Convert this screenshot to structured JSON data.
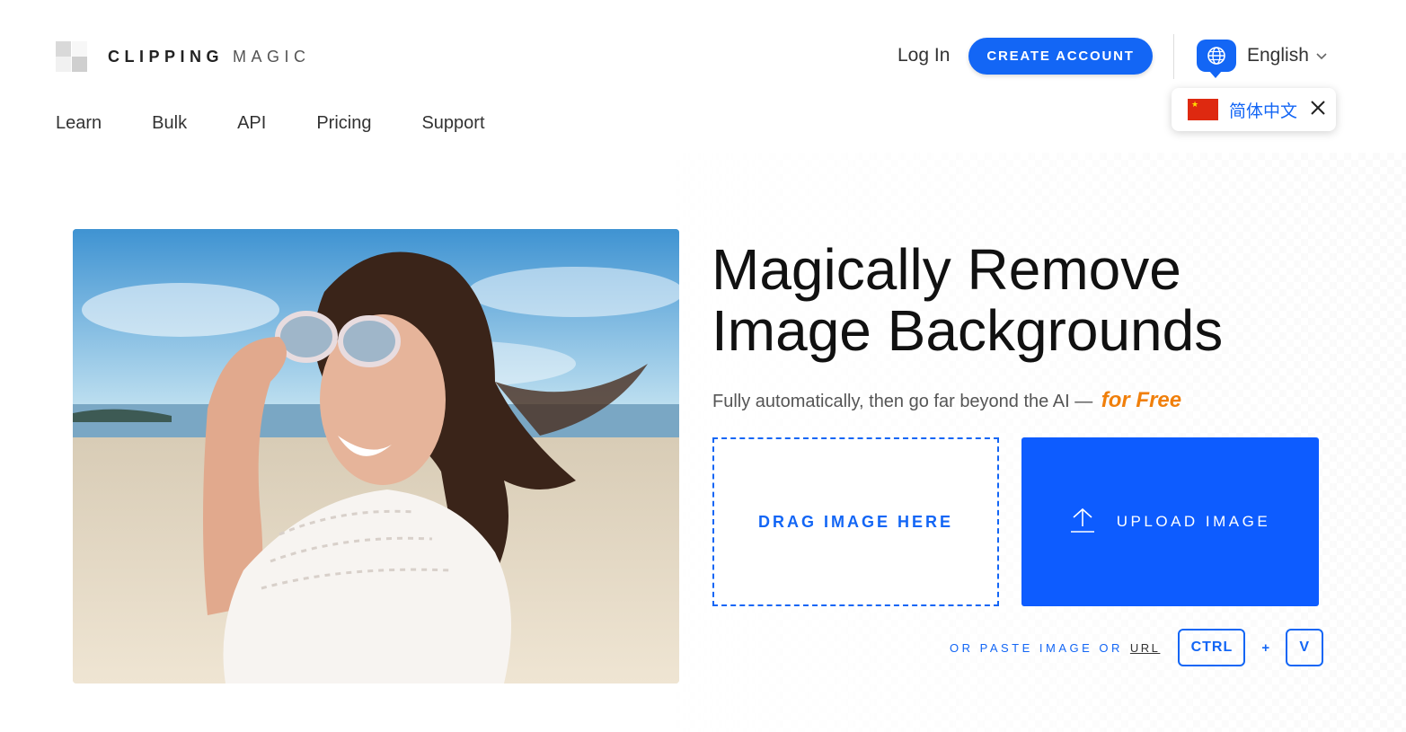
{
  "header": {
    "logo_bold": "CLIPPING",
    "logo_light": "MAGIC",
    "login_label": "Log In",
    "create_account_label": "CREATE ACCOUNT",
    "language_label": "English",
    "language_popup_label": "简体中文"
  },
  "nav": {
    "items": [
      {
        "label": "Learn"
      },
      {
        "label": "Bulk"
      },
      {
        "label": "API"
      },
      {
        "label": "Pricing"
      },
      {
        "label": "Support"
      }
    ]
  },
  "hero": {
    "headline_line1": "Magically Remove",
    "headline_line2": "Image Backgrounds",
    "subtitle": "Fully automatically, then go far beyond the AI —",
    "subtitle_highlight": "for Free",
    "drag_label": "DRAG IMAGE HERE",
    "upload_label": "UPLOAD IMAGE",
    "paste_text": "OR PASTE IMAGE OR",
    "paste_url": "URL",
    "key_ctrl": "CTRL",
    "key_plus": "+",
    "key_v": "V"
  },
  "colors": {
    "accent": "#1366f5",
    "upload": "#0d5cff",
    "highlight": "#f07f0b"
  },
  "icons": [
    "globe-icon",
    "chevron-down-icon",
    "china-flag-icon",
    "close-icon",
    "upload-icon"
  ]
}
